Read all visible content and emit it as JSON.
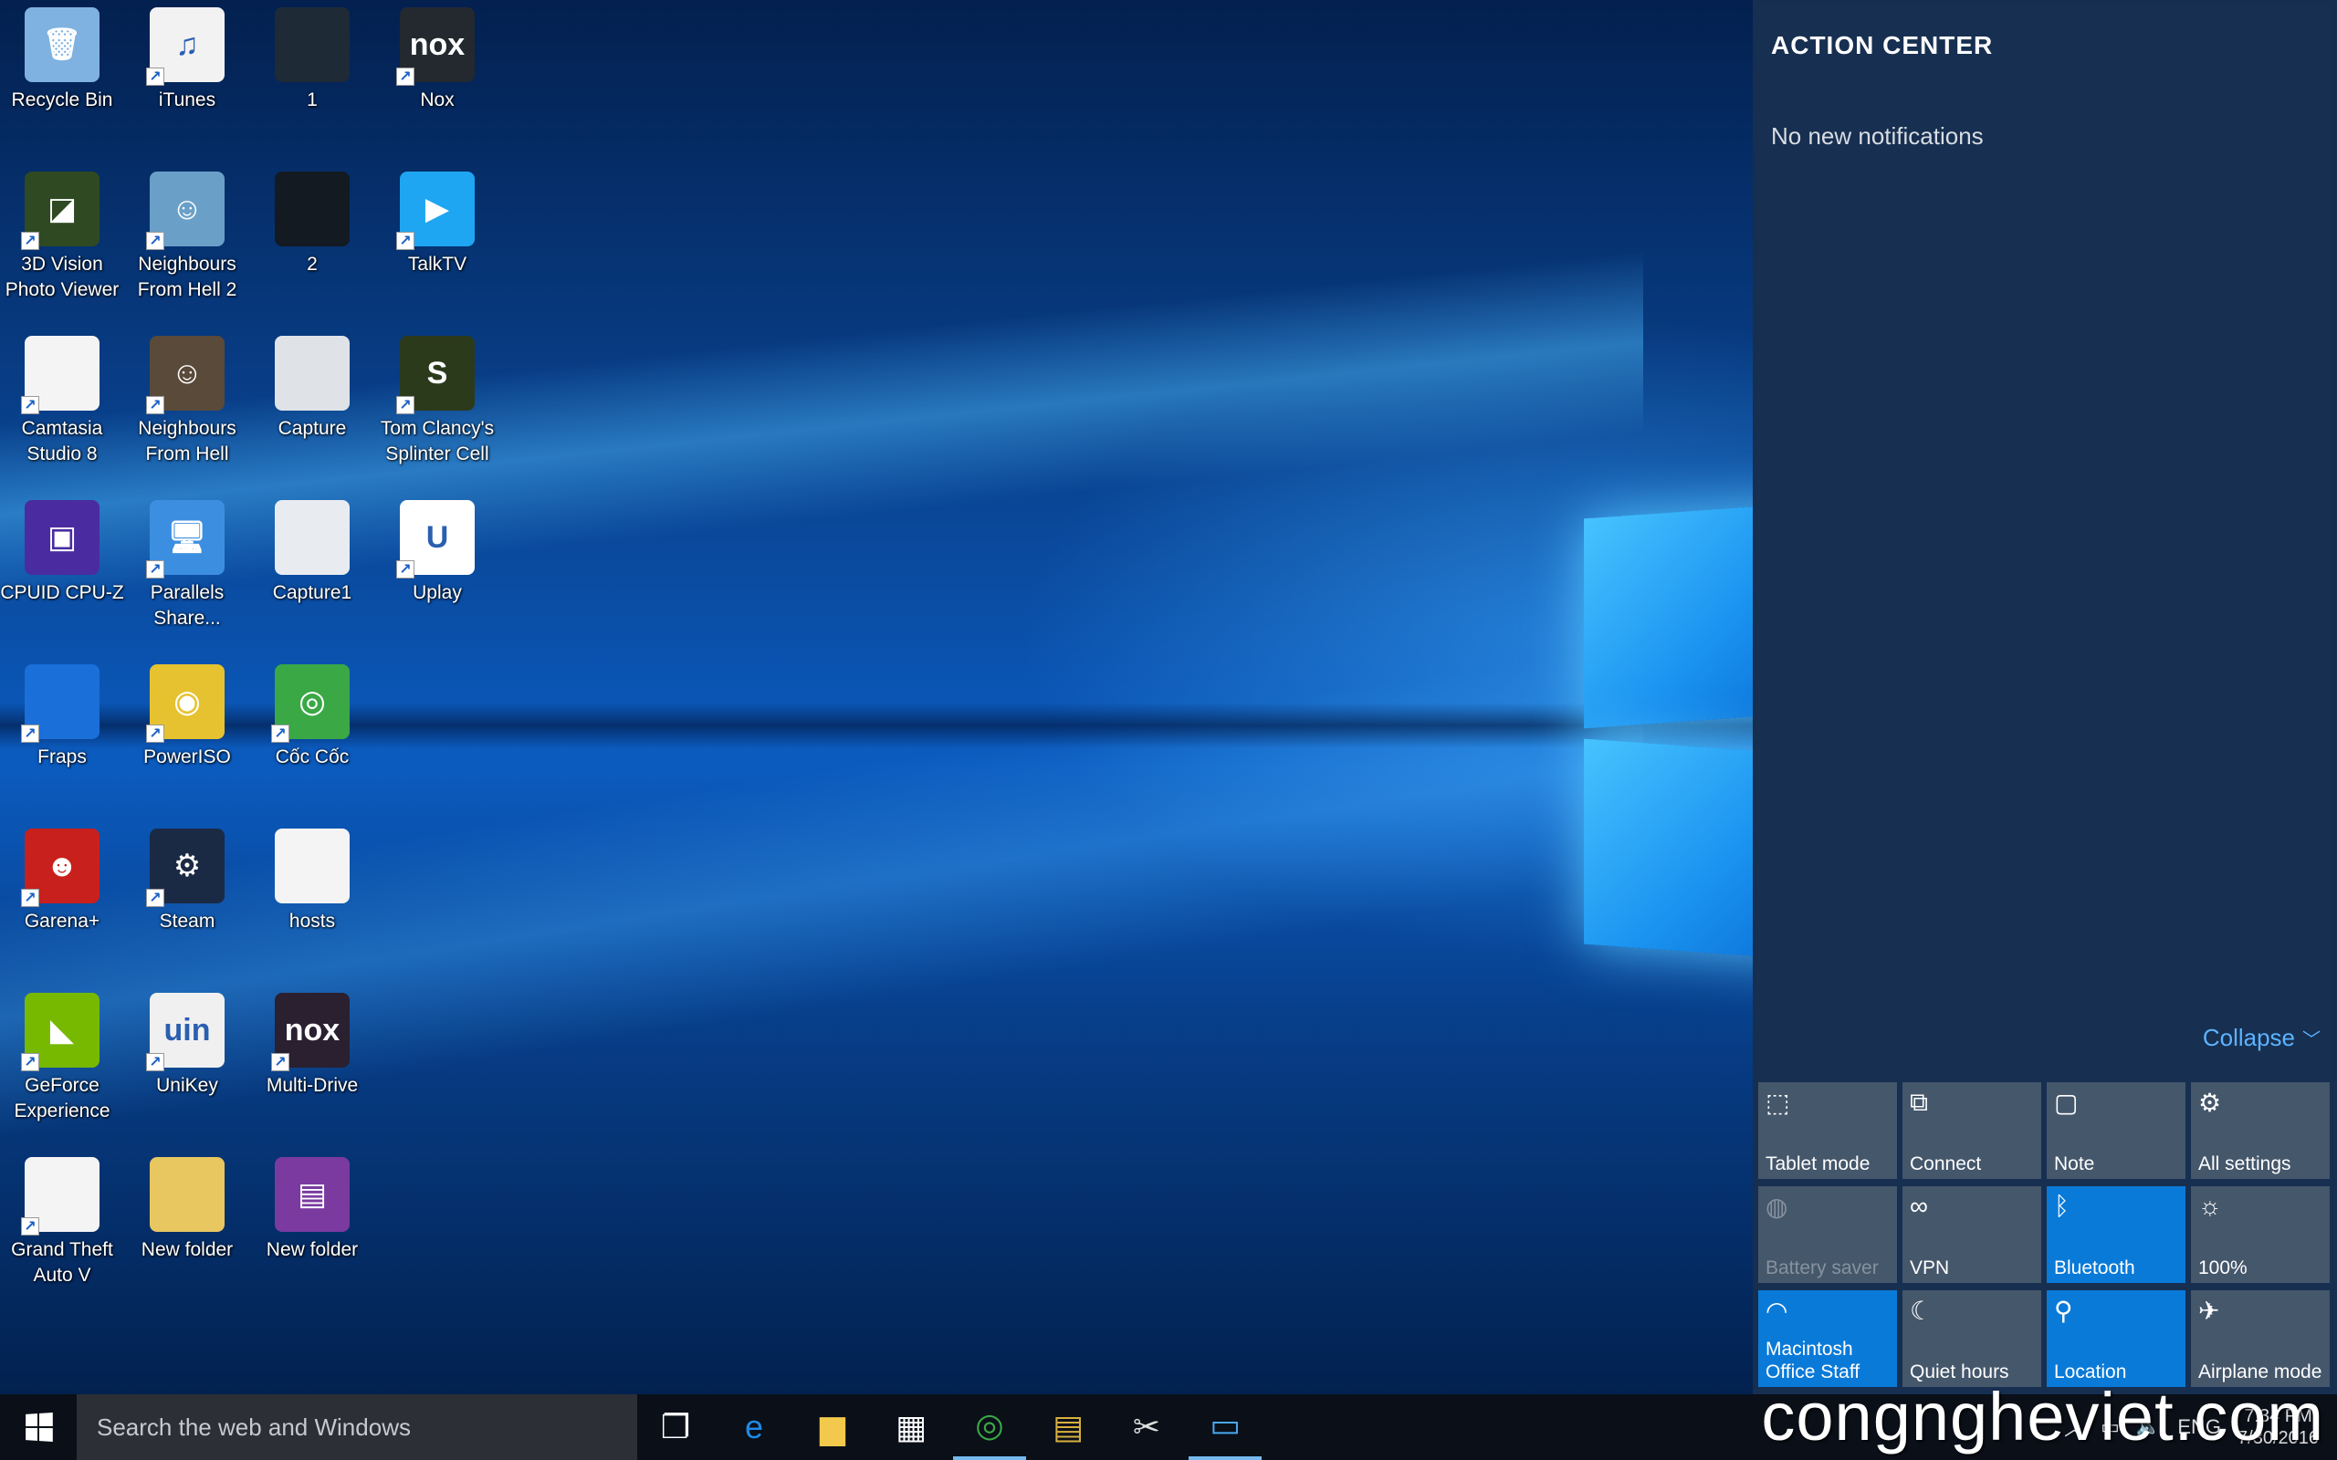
{
  "desktop": {
    "icons": [
      {
        "label": "Recycle Bin",
        "icon": "recycle-bin-icon",
        "glyph": "🗑",
        "color": "#7fb2e0",
        "shortcut": false
      },
      {
        "label": "iTunes",
        "icon": "itunes-icon",
        "glyph": "♫",
        "color": "#f2f2f2",
        "shortcut": true
      },
      {
        "label": "1",
        "icon": "image-thumbnail-icon",
        "glyph": "",
        "color": "#1e2a36",
        "shortcut": false
      },
      {
        "label": "Nox",
        "icon": "nox-icon",
        "glyph": "nox",
        "color": "#23292f",
        "shortcut": true
      },
      {
        "label": "3D Vision Photo Viewer",
        "icon": "3d-vision-icon",
        "glyph": "◪",
        "color": "#2f4a22",
        "shortcut": true
      },
      {
        "label": "Neighbours From Hell 2",
        "icon": "neighbours-from-hell-2-icon",
        "glyph": "☺",
        "color": "#6aa0c8",
        "shortcut": true
      },
      {
        "label": "2",
        "icon": "image-thumbnail-icon",
        "glyph": "",
        "color": "#141a22",
        "shortcut": false
      },
      {
        "label": "TalkTV",
        "icon": "talktv-icon",
        "glyph": "▶",
        "color": "#1ea6f2",
        "shortcut": true
      },
      {
        "label": "Camtasia Studio 8",
        "icon": "camtasia-icon",
        "glyph": "",
        "color": "#f4f4f4",
        "shortcut": true
      },
      {
        "label": "Neighbours From Hell",
        "icon": "neighbours-from-hell-icon",
        "glyph": "☺",
        "color": "#5a4a3a",
        "shortcut": true
      },
      {
        "label": "Capture",
        "icon": "image-thumbnail-icon",
        "glyph": "",
        "color": "#dfe3e8",
        "shortcut": false
      },
      {
        "label": "Tom Clancy's Splinter Cell",
        "icon": "splinter-cell-icon",
        "glyph": "S",
        "color": "#2c3a1c",
        "shortcut": true
      },
      {
        "label": "CPUID CPU-Z",
        "icon": "cpuz-icon",
        "glyph": "▣",
        "color": "#4a2ca0",
        "shortcut": false
      },
      {
        "label": "Parallels Share...",
        "icon": "parallels-share-icon",
        "glyph": "🖥",
        "color": "#3c8ee0",
        "shortcut": true
      },
      {
        "label": "Capture1",
        "icon": "image-thumbnail-icon",
        "glyph": "",
        "color": "#e8ecf0",
        "shortcut": false
      },
      {
        "label": "Uplay",
        "icon": "uplay-icon",
        "glyph": "U",
        "color": "#ffffff",
        "shortcut": true
      },
      {
        "label": "Fraps",
        "icon": "fraps-icon",
        "glyph": "",
        "color": "#1a6fd8",
        "shortcut": true
      },
      {
        "label": "PowerISO",
        "icon": "poweriso-icon",
        "glyph": "◉",
        "color": "#e6c230",
        "shortcut": true
      },
      {
        "label": "Cốc Cốc",
        "icon": "coccoc-icon",
        "glyph": "◎",
        "color": "#3aa845",
        "shortcut": true
      },
      {
        "label": "",
        "icon": "",
        "glyph": "",
        "color": "",
        "shortcut": false
      },
      {
        "label": "Garena+",
        "icon": "garena-icon",
        "glyph": "☻",
        "color": "#c8201c",
        "shortcut": true
      },
      {
        "label": "Steam",
        "icon": "steam-icon",
        "glyph": "⚙",
        "color": "#1b2a44",
        "shortcut": true
      },
      {
        "label": "hosts",
        "icon": "file-icon",
        "glyph": "",
        "color": "#f4f4f4",
        "shortcut": false
      },
      {
        "label": "",
        "icon": "",
        "glyph": "",
        "color": "",
        "shortcut": false
      },
      {
        "label": "GeForce Experience",
        "icon": "geforce-icon",
        "glyph": "◣",
        "color": "#76b900",
        "shortcut": true
      },
      {
        "label": "UniKey",
        "icon": "unikey-icon",
        "glyph": "uin",
        "color": "#f0f0f0",
        "shortcut": true
      },
      {
        "label": "Multi-Drive",
        "icon": "nox-multidrive-icon",
        "glyph": "nox",
        "color": "#2a2030",
        "shortcut": true
      },
      {
        "label": "",
        "icon": "",
        "glyph": "",
        "color": "",
        "shortcut": false
      },
      {
        "label": "Grand Theft Auto V",
        "icon": "file-icon",
        "glyph": "",
        "color": "#f4f4f4",
        "shortcut": true
      },
      {
        "label": "New folder",
        "icon": "folder-icon",
        "glyph": "",
        "color": "#e8c660",
        "shortcut": false
      },
      {
        "label": "New folder",
        "icon": "winrar-icon",
        "glyph": "▤",
        "color": "#7a3aa0",
        "shortcut": false
      }
    ]
  },
  "action_center": {
    "title": "ACTION CENTER",
    "empty_text": "No new notifications",
    "collapse_label": "Collapse",
    "tiles": [
      {
        "label": "Tablet mode",
        "icon": "tablet-mode-icon",
        "glyph": "⬚",
        "state": "off"
      },
      {
        "label": "Connect",
        "icon": "connect-icon",
        "glyph": "⧉",
        "state": "off"
      },
      {
        "label": "Note",
        "icon": "note-icon",
        "glyph": "▢",
        "state": "off"
      },
      {
        "label": "All settings",
        "icon": "gear-icon",
        "glyph": "⚙",
        "state": "off"
      },
      {
        "label": "Battery saver",
        "icon": "battery-saver-icon",
        "glyph": "◍",
        "state": "disabled"
      },
      {
        "label": "VPN",
        "icon": "vpn-icon",
        "glyph": "∞",
        "state": "off"
      },
      {
        "label": "Bluetooth",
        "icon": "bluetooth-icon",
        "glyph": "ᛒ",
        "state": "on"
      },
      {
        "label": "100%",
        "icon": "brightness-icon",
        "glyph": "☼",
        "state": "off"
      },
      {
        "label": "Macintosh Office Staff",
        "icon": "wifi-icon",
        "glyph": "◠",
        "state": "on"
      },
      {
        "label": "Quiet hours",
        "icon": "moon-icon",
        "glyph": "☾",
        "state": "off"
      },
      {
        "label": "Location",
        "icon": "location-icon",
        "glyph": "⚲",
        "state": "on"
      },
      {
        "label": "Airplane mode",
        "icon": "airplane-icon",
        "glyph": "✈",
        "state": "off"
      }
    ]
  },
  "taskbar": {
    "search_placeholder": "Search the web and Windows",
    "pinned": [
      {
        "name": "task-view-button",
        "icon": "task-view-icon",
        "glyph": "❐",
        "color": "#ffffff",
        "active": false
      },
      {
        "name": "edge-button",
        "icon": "edge-icon",
        "glyph": "e",
        "color": "#1e8ae6",
        "active": false
      },
      {
        "name": "file-explorer-button",
        "icon": "folder-icon",
        "glyph": "▆",
        "color": "#f2c94c",
        "active": false
      },
      {
        "name": "store-button",
        "icon": "store-icon",
        "glyph": "▦",
        "color": "#ffffff",
        "active": false
      },
      {
        "name": "coccoc-button",
        "icon": "coccoc-icon",
        "glyph": "◎",
        "color": "#3aa845",
        "active": true
      },
      {
        "name": "winrar-button",
        "icon": "archive-icon",
        "glyph": "▤",
        "color": "#d8b040",
        "active": false
      },
      {
        "name": "snipping-tool-button",
        "icon": "scissors-icon",
        "glyph": "✂",
        "color": "#dddddd",
        "active": false
      },
      {
        "name": "control-panel-button",
        "icon": "control-panel-icon",
        "glyph": "▭",
        "color": "#4aa8f0",
        "active": true
      }
    ],
    "tray_lang": "ENG",
    "clock_time": "7:34 PM",
    "clock_date": "7/30/2016"
  },
  "watermark": "congngheviet.com"
}
